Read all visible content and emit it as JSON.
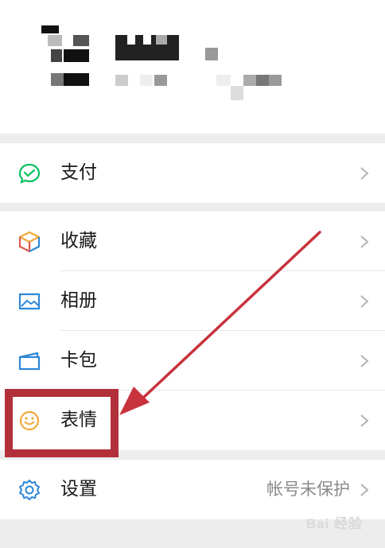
{
  "menu": {
    "payment": {
      "label": "支付"
    },
    "favorites": {
      "label": "收藏"
    },
    "album": {
      "label": "相册"
    },
    "cards": {
      "label": "卡包"
    },
    "stickers": {
      "label": "表情"
    },
    "settings": {
      "label": "设置",
      "status": "帐号未保护"
    }
  },
  "watermark": {
    "text": "Bai 经验"
  },
  "colors": {
    "background": "#ededed",
    "surface": "#ffffff",
    "pay_icon": "#07c160",
    "album_icon": "#2d87d6",
    "cards_icon": "#2d87d6",
    "sticker_icon": "#f2a93b",
    "settings_icon": "#2d87d6",
    "annotation": "#c8333d"
  },
  "icons": {
    "payment": "pay-check-icon",
    "favorites": "cube-icon",
    "album": "landscape-image-icon",
    "cards": "card-wallet-icon",
    "stickers": "smiley-face-icon",
    "settings": "gear-icon"
  }
}
